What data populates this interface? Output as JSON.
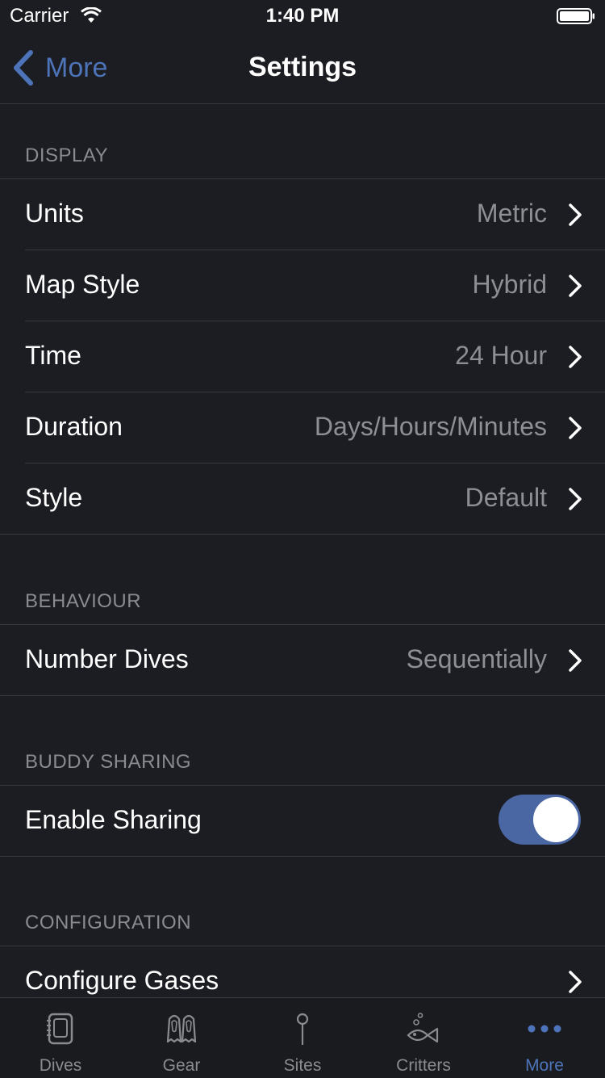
{
  "status": {
    "carrier": "Carrier",
    "time": "1:40 PM"
  },
  "nav": {
    "back_label": "More",
    "title": "Settings"
  },
  "sections": {
    "display": {
      "header": "DISPLAY",
      "rows": [
        {
          "label": "Units",
          "value": "Metric"
        },
        {
          "label": "Map Style",
          "value": "Hybrid"
        },
        {
          "label": "Time",
          "value": "24 Hour"
        },
        {
          "label": "Duration",
          "value": "Days/Hours/Minutes"
        },
        {
          "label": "Style",
          "value": "Default"
        }
      ]
    },
    "behaviour": {
      "header": "BEHAVIOUR",
      "rows": [
        {
          "label": "Number Dives",
          "value": "Sequentially"
        }
      ]
    },
    "buddy_sharing": {
      "header": "BUDDY SHARING",
      "rows": [
        {
          "label": "Enable Sharing",
          "toggle_on": true
        }
      ]
    },
    "configuration": {
      "header": "CONFIGURATION",
      "rows": [
        {
          "label": "Configure Gases",
          "value": ""
        }
      ]
    }
  },
  "tabs": [
    {
      "label": "Dives",
      "icon": "dive-log-icon"
    },
    {
      "label": "Gear",
      "icon": "fins-icon"
    },
    {
      "label": "Sites",
      "icon": "pin-icon"
    },
    {
      "label": "Critters",
      "icon": "fish-icon"
    },
    {
      "label": "More",
      "icon": "more-dots-icon",
      "active": true
    }
  ],
  "colors": {
    "accent": "#4d74b8",
    "background": "#1c1d22",
    "toggle_on": "#4a67a3",
    "secondary_text": "#8e8f94"
  }
}
